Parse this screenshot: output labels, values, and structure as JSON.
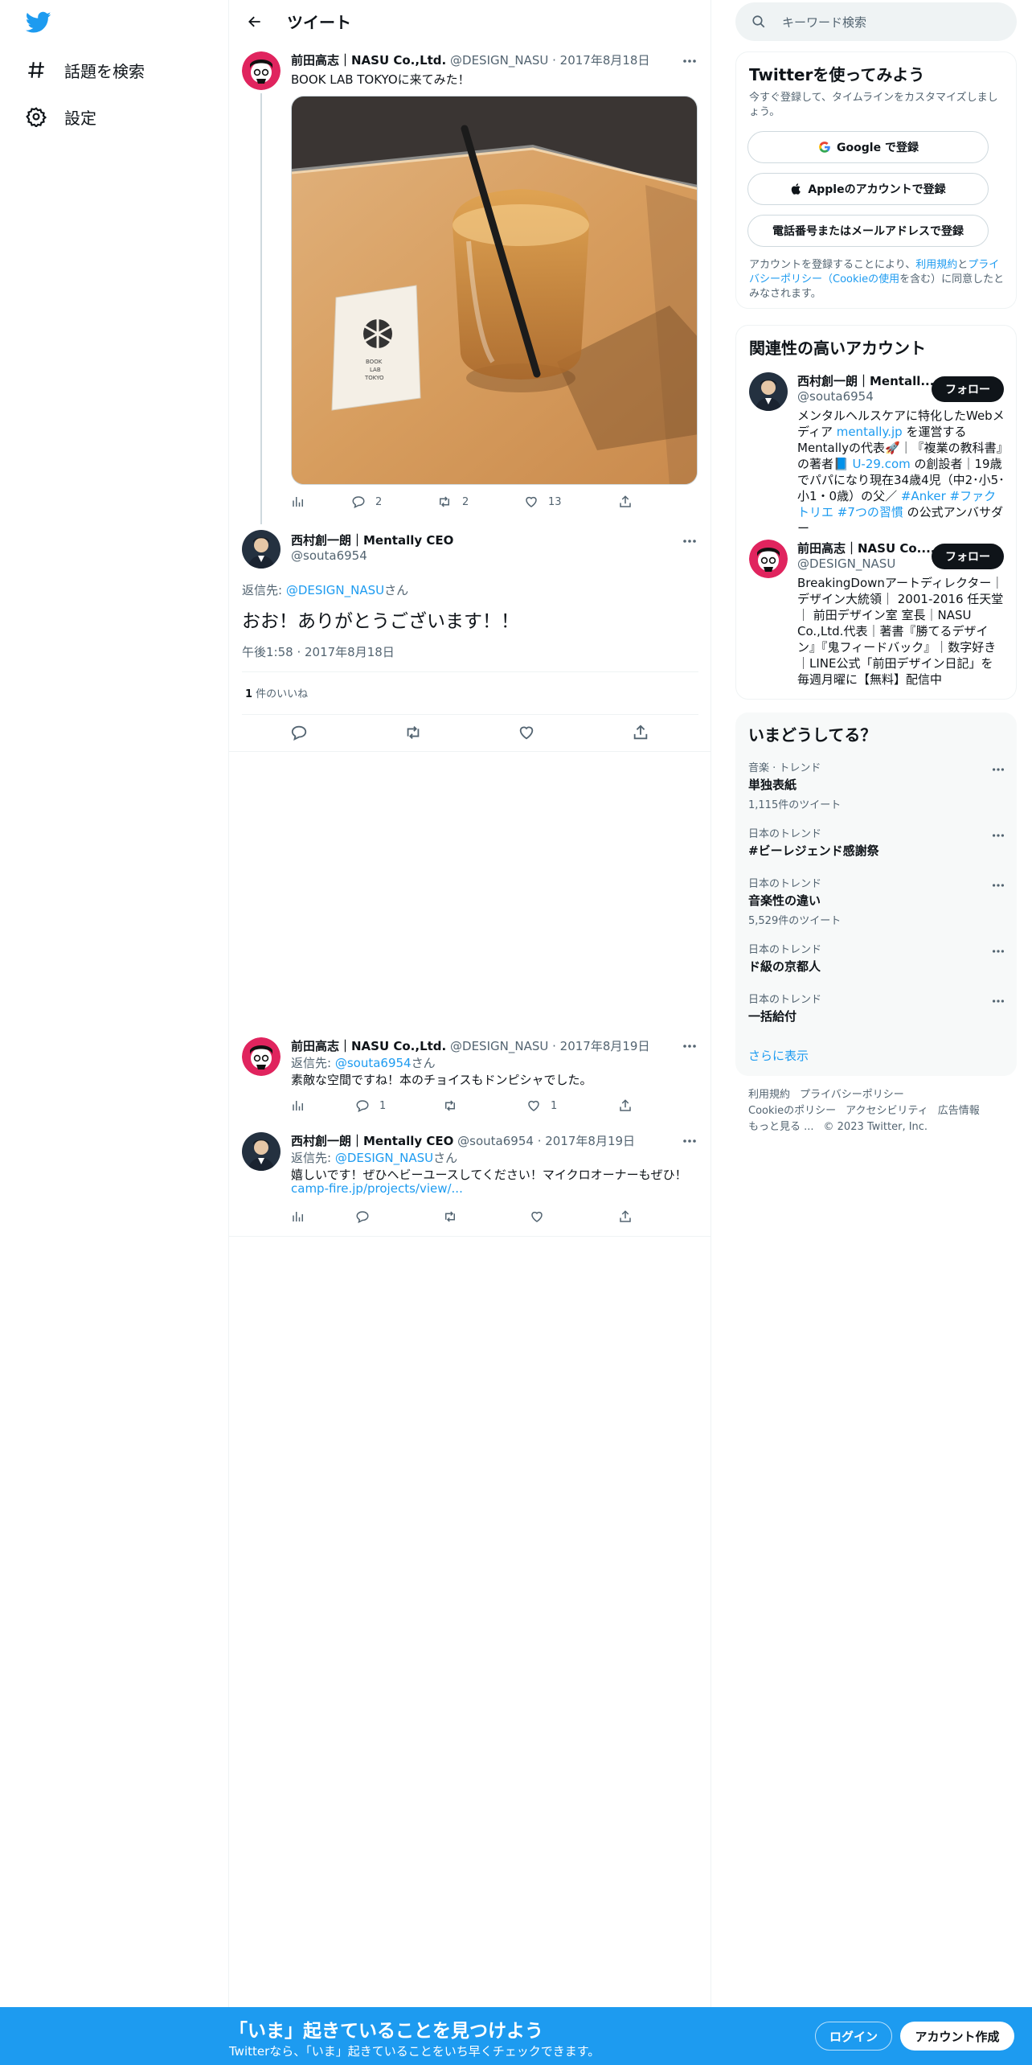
{
  "nav": {
    "explore_label": "話題を検索",
    "settings_label": "設定"
  },
  "header": {
    "title": "ツイート"
  },
  "thread": {
    "parent": {
      "name": "前田高志｜NASU Co.,Ltd.",
      "handle": "@DESIGN_NASU",
      "date": "2017年8月18日",
      "text": "BOOK LAB TOKYOに来てみた！",
      "photo_caption": "BOOK LAB TOKYO",
      "stats": {
        "replies": "2",
        "retweets": "2",
        "likes": "13"
      }
    },
    "main": {
      "name": "西村創一朗｜Mentally CEO",
      "handle": "@souta6954",
      "reply_prefix": "返信先: ",
      "reply_to": "@DESIGN_NASU",
      "reply_suffix": "さん",
      "text": "おお！ありがとうございます！！",
      "timestamp": "午後1:58 · 2017年8月18日",
      "likes_count": "1",
      "likes_label": " 件のいいね"
    },
    "replies": [
      {
        "name": "前田高志｜NASU Co.,Ltd.",
        "handle": "@DESIGN_NASU",
        "date": "2017年8月19日",
        "reply_prefix": "返信先: ",
        "reply_to": "@souta6954",
        "reply_suffix": "さん",
        "text": "素敵な空間ですね！本のチョイスもドンピシャでした。",
        "replies": "1",
        "likes": "1"
      },
      {
        "name": "西村創一朗｜Mentally CEO",
        "handle": "@souta6954",
        "date": "2017年8月19日",
        "reply_prefix": "返信先: ",
        "reply_to": "@DESIGN_NASU",
        "reply_suffix": "さん",
        "text": "嬉しいです！ぜひヘビーユースしてください！マイクロオーナーもぜひ！",
        "link": "camp-fire.jp/projects/view/..."
      }
    ]
  },
  "search": {
    "placeholder": "キーワード検索"
  },
  "signup_card": {
    "title": "Twitterを使ってみよう",
    "subtitle": "今すぐ登録して、タイムラインをカスタマイズしましょう。",
    "google": "Google で登録",
    "apple": "Appleのアカウントで登録",
    "phone": "電話番号またはメールアドレスで登録",
    "terms_1": "アカウントを登録することにより、",
    "terms_link1": "利用規約",
    "terms_2": "と",
    "terms_link2": "プライバシーポリシー（Cookieの使用",
    "terms_3": "を含む）に同意したとみなされます。"
  },
  "related": {
    "title": "関連性の高いアカウント",
    "follow_label": "フォロー",
    "accounts": [
      {
        "name": "西村創一朗｜Mentall...",
        "handle": "@souta6954",
        "bio_1": "メンタルヘルスケアに特化したWebメディア ",
        "bio_link1": "mentally.jp",
        "bio_2": " を運営するMentallyの代表🚀｜『複業の教科書』の著者📘 ",
        "bio_link2": "U-29.com",
        "bio_3": " の創設者｜19歳でパパになり現在34歳4児（中2･小5･小1・0歳）の父／ ",
        "bio_link3": "#Anker #ファクトリエ #7つの習慣",
        "bio_4": " の公式アンバサダー"
      },
      {
        "name": "前田高志｜NASU Co....",
        "handle": "@DESIGN_NASU",
        "bio": "BreakingDownアートディレクター｜デザイン大統領｜ 2001-2016 任天堂｜ 前田デザイン室 室長｜NASU Co.,Ltd.代表｜著書『勝てるデザイン』『鬼フィードバック』｜数字好き｜LINE公式「前田デザイン日記」を毎週月曜に【無料】配信中"
      }
    ]
  },
  "trends": {
    "title": "いまどうしてる？",
    "items": [
      {
        "category": "音楽 · トレンド",
        "name": "単独表紙",
        "count": "1,115件のツイート"
      },
      {
        "category": "日本のトレンド",
        "name": "#ビーレジェンド感謝祭",
        "count": ""
      },
      {
        "category": "日本のトレンド",
        "name": "音楽性の違い",
        "count": "5,529件のツイート"
      },
      {
        "category": "日本のトレンド",
        "name": "ド級の京都人",
        "count": ""
      },
      {
        "category": "日本のトレンド",
        "name": "一括給付",
        "count": ""
      }
    ],
    "show_more": "さらに表示"
  },
  "footer": {
    "terms": "利用規約",
    "privacy": "プライバシーポリシー",
    "cookie": "Cookieのポリシー",
    "accessibility": "アクセシビリティ",
    "ads": "広告情報",
    "more": "もっと見る ...",
    "copyright": "© 2023 Twitter, Inc."
  },
  "bottom_bar": {
    "title": "「いま」起きていることを見つけよう",
    "subtitle": "Twitterなら、「いま」起きていることをいち早くチェックできます。",
    "login": "ログイン",
    "signup": "アカウント作成"
  },
  "colors": {
    "accent": "#1d9bf0",
    "text": "#0f1419",
    "muted": "#536471",
    "border": "#eff3f4"
  }
}
